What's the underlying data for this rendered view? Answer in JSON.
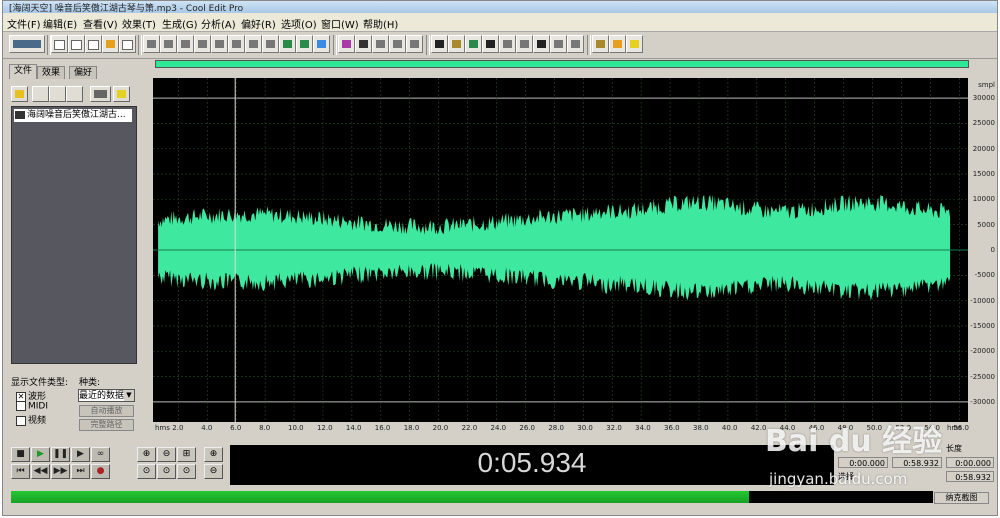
{
  "window": {
    "title": "[海阔天空] 噪音后笑傲江湖古琴与箫.mp3 - Cool Edit Pro"
  },
  "menu": [
    "文件(F)",
    "编辑(E)",
    "查看(V)",
    "效果(T)",
    "生成(G)",
    "分析(A)",
    "偏好(R)",
    "选项(O)",
    "窗口(W)",
    "帮助(H)"
  ],
  "left_panel": {
    "tabs": [
      "文件",
      "效果",
      "偏好"
    ],
    "file_item": "海阔噪音后笑傲江湖古...",
    "filter_label": "显示文件类型:",
    "kind_label": "种类:",
    "types": [
      "波形",
      "MIDI",
      "视频"
    ],
    "sort_select": "最近的数据",
    "auto_play": "自动播放",
    "full_path": "完整路径"
  },
  "waveform": {
    "unit_label": "smpl",
    "amplitude_labels": [
      "30000",
      "25000",
      "20000",
      "15000",
      "10000",
      "5000",
      "0",
      "-5000",
      "-10000",
      "-15000",
      "-20000",
      "-25000",
      "-30000"
    ],
    "time_unit": "hms",
    "time_labels": [
      "2.0",
      "4.0",
      "6.0",
      "8.0",
      "10.0",
      "12.0",
      "14.0",
      "16.0",
      "18.0",
      "20.0",
      "22.0",
      "24.0",
      "26.0",
      "28.0",
      "30.0",
      "32.0",
      "34.0",
      "36.0",
      "38.0",
      "40.0",
      "42.0",
      "44.0",
      "46.0",
      "48.0",
      "50.0",
      "52.0",
      "54.0",
      "56.0"
    ],
    "cursor_time_s": 5.934,
    "duration_s": 58.932,
    "wave_color": "#3ee89e",
    "background": "#000000"
  },
  "time_display": "0:05.934",
  "info": {
    "length_label": "长度",
    "selection_label": "选择",
    "start_value": "0:00.000",
    "end_value": "0:58.932",
    "length_value": "0:00.000",
    "length_value2": "0:58.932"
  },
  "level": {
    "fill": 0.8,
    "button_label": "纳克截图"
  },
  "watermark": {
    "logo": "Bai du 经验",
    "url": "jingyan.baidu.com"
  }
}
